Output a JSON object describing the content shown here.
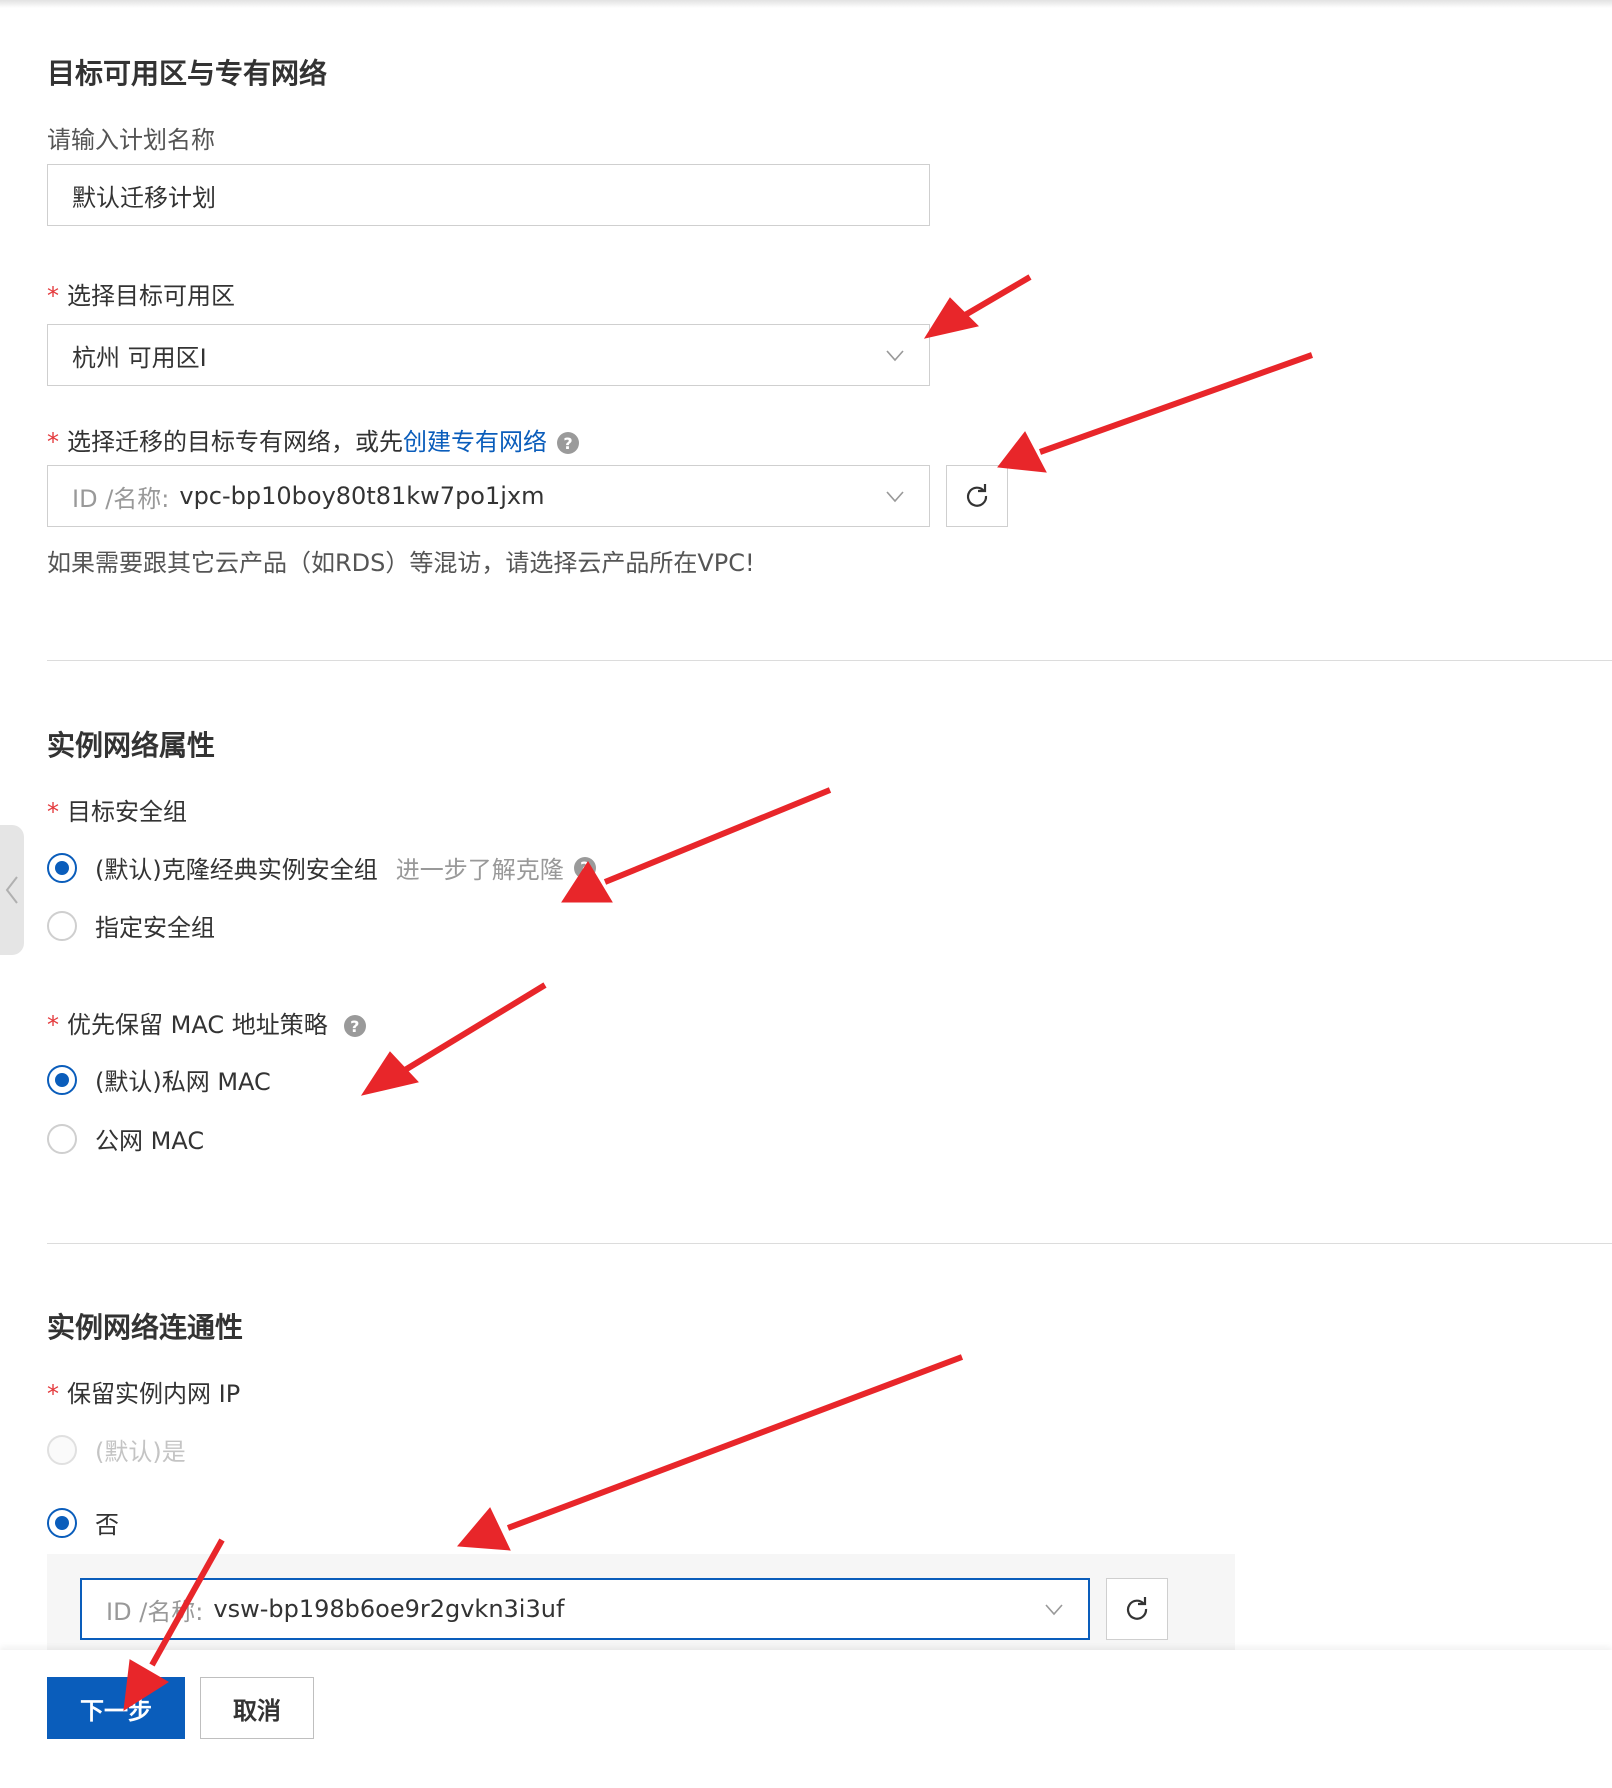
{
  "section1": {
    "title": "目标可用区与专有网络",
    "plan_name_label": "请输入计划名称",
    "plan_name_value": "默认迁移计划",
    "zone_label": "选择目标可用区",
    "zone_value": "杭州 可用区I",
    "vpc_label_prefix": "选择迁移的目标专有网络，或先",
    "vpc_create_link": "创建专有网络",
    "vpc_id_prefix": "ID /名称:",
    "vpc_value": "vpc-bp10boy80t81kw7po1jxm",
    "vpc_hint": "如果需要跟其它云产品（如RDS）等混访，请选择云产品所在VPC!"
  },
  "section2": {
    "title": "实例网络属性",
    "security_group_label": "目标安全组",
    "sg_option_default": "(默认)克隆经典实例安全组",
    "sg_learn_more": "进一步了解克隆",
    "sg_option_custom": "指定安全组",
    "mac_label": "优先保留 MAC 地址策略",
    "mac_option_private": "(默认)私网 MAC",
    "mac_option_public": "公网 MAC"
  },
  "section3": {
    "title": "实例网络连通性",
    "keep_ip_label": "保留实例内网 IP",
    "keep_ip_yes": "(默认)是",
    "keep_ip_no": "否",
    "vsw_id_prefix": "ID /名称:",
    "vsw_value": "vsw-bp198b6oe9r2gvkn3i3uf"
  },
  "footer": {
    "next_label": "下一步",
    "cancel_label": "取消"
  },
  "icons": {
    "help": "?",
    "required": "*"
  },
  "colors": {
    "primary": "#0a5dbb",
    "required": "#e4393c",
    "annotation_arrow": "#e8262a"
  }
}
